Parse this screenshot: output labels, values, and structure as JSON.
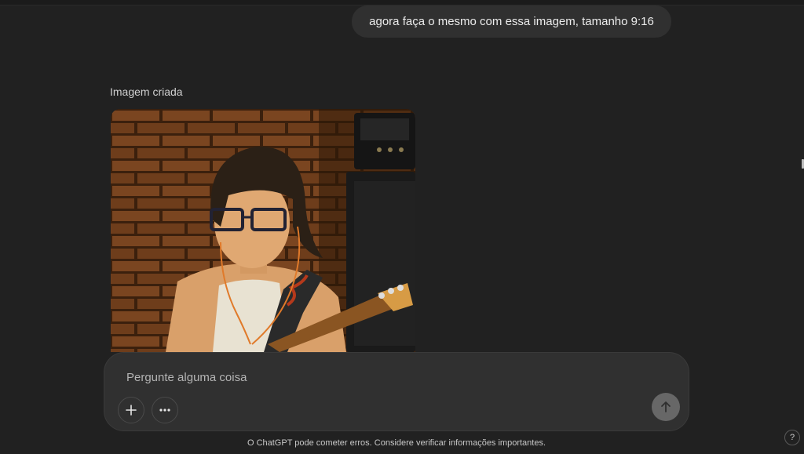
{
  "conversation": {
    "user_message": "agora faça o mesmo com essa imagem, tamanho 9:16",
    "generated_label": "Imagem criada",
    "image_icon": "download-icon"
  },
  "composer": {
    "placeholder": "Pergunte alguma coisa",
    "add_icon": "plus-icon",
    "tools_icon": "more-icon",
    "send_icon": "arrow-up-icon"
  },
  "footer": {
    "disclaimer": "O ChatGPT pode cometer erros. Considere verificar informações importantes.",
    "help_label": "?"
  },
  "colors": {
    "background": "#212121",
    "bubble": "#303030",
    "composer": "#303030",
    "send_button": "#676767"
  }
}
